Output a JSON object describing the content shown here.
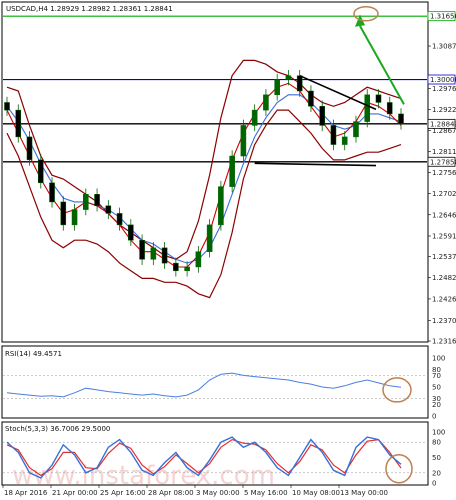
{
  "chart_data": [
    {
      "type": "candlestick",
      "title": "USDCAD,H4  1.28929  1.28982  1.28361  1.28841",
      "price_axis_ticks": [
        "1.31656",
        "1.30875",
        "1.30000",
        "1.29765",
        "1.29220",
        "1.28841",
        "1.28670",
        "1.28115",
        "1.27850",
        "1.27565",
        "1.27020",
        "1.26465",
        "1.25910",
        "1.25370",
        "1.24820",
        "1.24265",
        "1.23705",
        "1.23165"
      ],
      "ylim": [
        1.23165,
        1.32
      ],
      "highlighted_levels": [
        {
          "label": "1.31656",
          "value": 1.31656,
          "color": "#00aa00"
        },
        {
          "label": "1.30000",
          "value": 1.3,
          "color": "#0000cc"
        },
        {
          "label": "1.28841",
          "value": 1.28841,
          "color": "#000000"
        },
        {
          "label": "1.27850",
          "value": 1.2785,
          "color": "#000000"
        }
      ],
      "close_series_sampled": [
        1.292,
        1.285,
        1.279,
        1.273,
        1.268,
        1.262,
        1.266,
        1.27,
        1.267,
        1.265,
        1.262,
        1.258,
        1.253,
        1.256,
        1.252,
        1.25,
        1.251,
        1.255,
        1.262,
        1.272,
        1.28,
        1.288,
        1.292,
        1.296,
        1.3,
        1.301,
        1.297,
        1.293,
        1.288,
        1.283,
        1.285,
        1.289,
        1.296,
        1.294,
        1.291,
        1.2884
      ],
      "upper_band": [
        1.298,
        1.297,
        1.288,
        1.28,
        1.275,
        1.274,
        1.272,
        1.27,
        1.268,
        1.265,
        1.262,
        1.26,
        1.258,
        1.256,
        1.254,
        1.253,
        1.255,
        1.263,
        1.275,
        1.29,
        1.301,
        1.305,
        1.305,
        1.304,
        1.302,
        1.301,
        1.299,
        1.296,
        1.294,
        1.293,
        1.294,
        1.296,
        1.298,
        1.297,
        1.296,
        1.295
      ],
      "lower_band": [
        1.286,
        1.28,
        1.272,
        1.264,
        1.258,
        1.256,
        1.258,
        1.258,
        1.257,
        1.255,
        1.252,
        1.25,
        1.248,
        1.248,
        1.247,
        1.247,
        1.246,
        1.244,
        1.243,
        1.249,
        1.26,
        1.274,
        1.283,
        1.288,
        1.292,
        1.292,
        1.289,
        1.286,
        1.282,
        1.279,
        1.279,
        1.28,
        1.281,
        1.281,
        1.282,
        1.283
      ],
      "ma_fast": [
        1.292,
        1.286,
        1.28,
        1.274,
        1.269,
        1.265,
        1.266,
        1.268,
        1.267,
        1.265,
        1.262,
        1.258,
        1.255,
        1.255,
        1.253,
        1.251,
        1.251,
        1.254,
        1.26,
        1.27,
        1.279,
        1.286,
        1.291,
        1.295,
        1.298,
        1.299,
        1.297,
        1.293,
        1.289,
        1.285,
        1.286,
        1.289,
        1.294,
        1.293,
        1.291,
        1.288
      ],
      "ma_slow": [
        1.293,
        1.289,
        1.284,
        1.278,
        1.273,
        1.269,
        1.268,
        1.268,
        1.267,
        1.266,
        1.264,
        1.261,
        1.258,
        1.257,
        1.255,
        1.253,
        1.252,
        1.253,
        1.256,
        1.262,
        1.27,
        1.278,
        1.285,
        1.29,
        1.294,
        1.296,
        1.296,
        1.294,
        1.291,
        1.288,
        1.287,
        1.288,
        1.291,
        1.291,
        1.29,
        1.289
      ],
      "x_axis_labels": [
        "18 Apr 2016",
        "21 Apr 00:00",
        "25 Apr 16:00",
        "28 Apr 08:00",
        "3 May 00:00",
        "5 May 16:00",
        "10 May 08:00",
        "13 May 00:00"
      ]
    },
    {
      "type": "line",
      "title": "RSI(14) 49.4571",
      "ylim": [
        0,
        100
      ],
      "y_ticks": [
        "100",
        "80",
        "70",
        "50",
        "30",
        "20",
        "0"
      ],
      "values": [
        40,
        38,
        36,
        34,
        35,
        33,
        40,
        48,
        45,
        42,
        40,
        38,
        36,
        38,
        35,
        33,
        36,
        45,
        62,
        72,
        74,
        70,
        68,
        66,
        64,
        62,
        58,
        55,
        50,
        48,
        52,
        58,
        62,
        57,
        52,
        49.4571
      ]
    },
    {
      "type": "line",
      "title": "Stoch(5,3,3) 36.7006 29.5000",
      "ylim": [
        0,
        100
      ],
      "y_ticks": [
        "100",
        "80",
        "50",
        "20",
        "0"
      ],
      "series": [
        {
          "values": [
            80,
            60,
            20,
            10,
            35,
            75,
            55,
            20,
            30,
            70,
            85,
            60,
            25,
            15,
            40,
            60,
            30,
            15,
            45,
            80,
            90,
            70,
            80,
            60,
            30,
            15,
            50,
            85,
            60,
            25,
            15,
            70,
            90,
            85,
            55,
            36.7
          ]
        },
        {
          "values": [
            75,
            65,
            30,
            15,
            28,
            60,
            60,
            30,
            28,
            58,
            78,
            68,
            35,
            18,
            32,
            55,
            38,
            20,
            38,
            70,
            85,
            78,
            76,
            65,
            38,
            20,
            42,
            75,
            65,
            35,
            20,
            55,
            82,
            85,
            60,
            29.5
          ]
        }
      ]
    }
  ],
  "watermark": "www.instaforex.com"
}
